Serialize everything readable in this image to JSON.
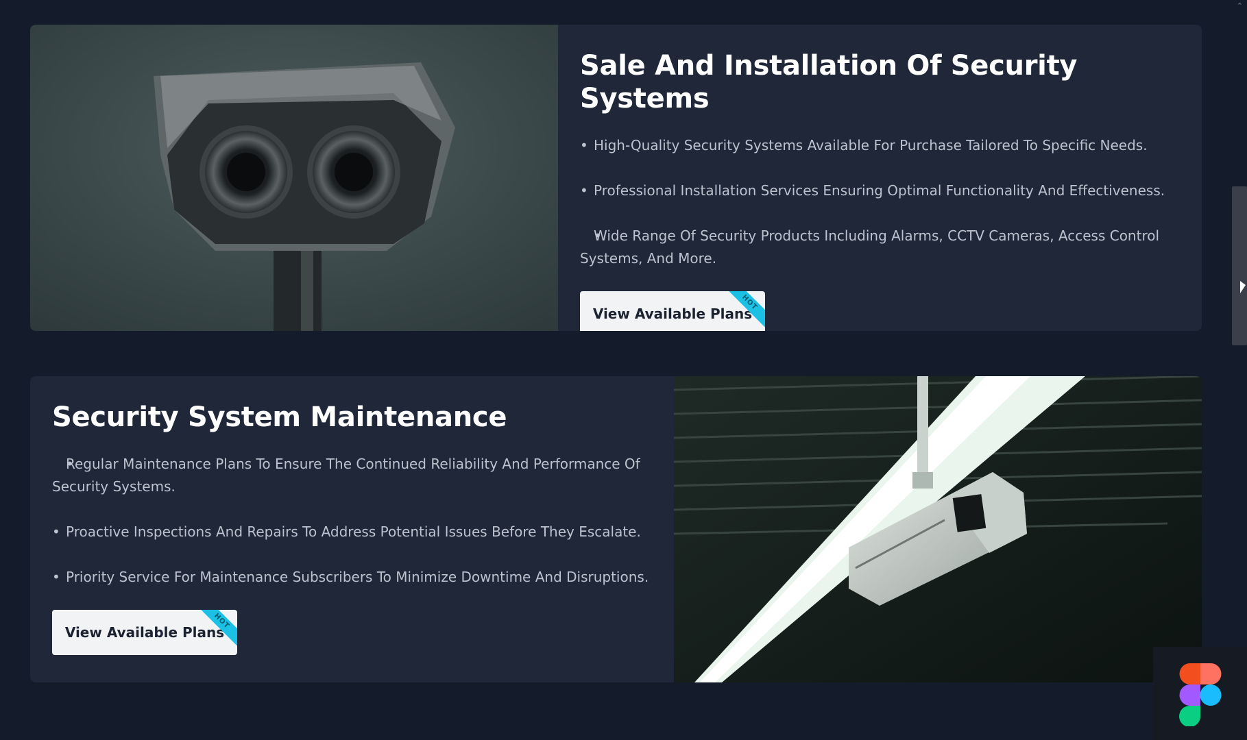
{
  "sections": [
    {
      "title": "Sale And Installation Of Security Systems",
      "features": [
        "High-Quality Security Systems Available For Purchase Tailored To Specific Needs.",
        "Professional Installation Services Ensuring Optimal Functionality And Effectiveness.",
        "Wide Range Of Security Products Including Alarms, CCTV Cameras, Access Control Systems, And More."
      ],
      "cta_label": "View Available Plans",
      "badge": "HOT"
    },
    {
      "title": "Security System Maintenance",
      "features": [
        "Regular Maintenance Plans To Ensure The Continued Reliability And Performance Of Security Systems.",
        "Proactive Inspections And Repairs To Address Potential Issues Before They Escalate.",
        "Priority Service For Maintenance Subscribers To Minimize Downtime And Disruptions."
      ],
      "cta_label": "View Available Plans",
      "badge": "HOT"
    }
  ],
  "icons": {
    "scroll_up": "chevron-up-icon",
    "app_badge": "figma-logo-icon"
  },
  "colors": {
    "background": "#141b2b",
    "card": "#1f2738",
    "accent": "#1cc0e4",
    "button": "#f2f3f5"
  }
}
